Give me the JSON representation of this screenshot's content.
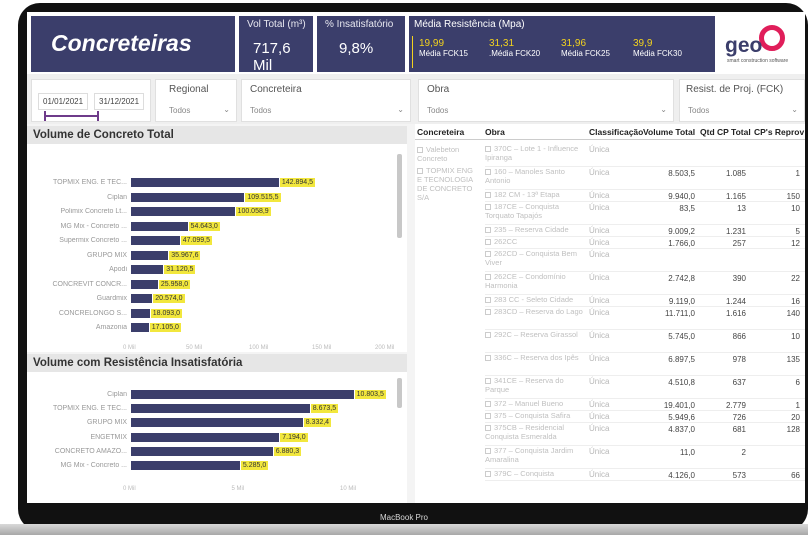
{
  "device_label": "MacBook Pro",
  "header": {
    "title": "Concreteiras",
    "kpis": [
      {
        "label": "Vol Total (m³)",
        "value": "717,6 Mil"
      },
      {
        "label": "% Insatisfatório",
        "value": "9,8%"
      }
    ],
    "resistencia": {
      "label": "Média Resistência (Mpa)",
      "items": [
        {
          "value": "19,99",
          "name": "Média FCK15"
        },
        {
          "value": "31,31",
          "name": ".Média FCK20"
        },
        {
          "value": "31,96",
          "name": "Média FCK25"
        },
        {
          "value": "39,9",
          "name": "Média FCK30"
        }
      ]
    },
    "logo": {
      "text": "geo",
      "sub": "smart construction software"
    }
  },
  "filters": {
    "date_start": "01/01/2021",
    "date_end": "31/12/2021",
    "regional": {
      "label": "Regional",
      "value": "Todos"
    },
    "concreteira": {
      "label": "Concreteira",
      "value": "Todos"
    },
    "obra": {
      "label": "Obra",
      "value": "Todos"
    },
    "fck": {
      "label": "Resist. de Proj. (FCK)",
      "value": "Todos"
    }
  },
  "chart_data": [
    {
      "type": "bar",
      "title": "Volume de Concreto Total",
      "categories": [
        "TOPMIX ENG. E TEC...",
        "Ciplan",
        "Polimix Concreto Lt...",
        "MG Mix - Concreto ...",
        "Supermix Concreto ...",
        "GRUPO MIX",
        "Apodi",
        "CONCREVIT CONCR...",
        "Guardmix",
        "CONCRELONGO S...",
        "Amazonia"
      ],
      "values": [
        142894.5,
        109515.5,
        100058.9,
        54643.0,
        47099.5,
        35967.6,
        31120.5,
        25958.0,
        20574.0,
        18093.0,
        17105.0
      ],
      "labels": [
        "142.894,5",
        "109.515,5",
        "100.058,9",
        "54.643,0",
        "47.099,5",
        "35.967,6",
        "31.120,5",
        "25.958,0",
        "20.574,0",
        "18.093,0",
        "17.105,0"
      ],
      "xticks": [
        "0 Mil",
        "50 Mil",
        "100 Mil",
        "150 Mil",
        "200 Mil"
      ],
      "xlim": [
        0,
        200000
      ]
    },
    {
      "type": "bar",
      "title": "Volume com Resistência Insatisfatória",
      "categories": [
        "Ciplan",
        "TOPMIX ENG. E TEC...",
        "GRUPO MIX",
        "ENGETMIX",
        "CONCRETO AMAZO...",
        "MG Mix - Concreto ..."
      ],
      "values": [
        10803.5,
        8673.5,
        8332.4,
        7194.0,
        6880.3,
        5285.0
      ],
      "labels": [
        "10.803,5",
        "8.673,5",
        "8.332,4",
        "7.194,0",
        "6.880,3",
        "5.285,0"
      ],
      "xticks": [
        "0 Mil",
        "5 Mil",
        "10 Mil"
      ],
      "xlim": [
        0,
        11500
      ]
    }
  ],
  "table": {
    "columns": [
      "Concreteira",
      "Obra",
      "Classificação",
      "Volume Total",
      "Qtd CP Total",
      "CP's Reprov"
    ],
    "concreteiras": [
      "Valebeton Concreto",
      "TOPMIX ENG E TECNOLOGIA DE CONCRETO S/A"
    ],
    "rows": [
      {
        "obra": "370C – Lote 1 - Influence Ipiranga",
        "class": "Única",
        "vol": "",
        "qtd": "",
        "rep": ""
      },
      {
        "obra": "160 – Manoles Santo Antonio",
        "class": "Única",
        "vol": "8.503,5",
        "qtd": "1.085",
        "rep": "1"
      },
      {
        "obra": "182 CM - 13ª Etapa",
        "class": "Única",
        "vol": "9.940,0",
        "qtd": "1.165",
        "rep": "150"
      },
      {
        "obra": "187CE – Conquista Torquato Tapajós",
        "class": "Única",
        "vol": "83,5",
        "qtd": "13",
        "rep": "10"
      },
      {
        "obra": "235 – Reserva Cidade",
        "class": "Única",
        "vol": "9.009,2",
        "qtd": "1.231",
        "rep": "5"
      },
      {
        "obra": "262CC",
        "class": "Única",
        "vol": "1.766,0",
        "qtd": "257",
        "rep": "12"
      },
      {
        "obra": "262CD – Conquista Bem Viver",
        "class": "Única",
        "vol": "",
        "qtd": "",
        "rep": ""
      },
      {
        "obra": "262CE – Condomínio Harmonia",
        "class": "Única",
        "vol": "2.742,8",
        "qtd": "390",
        "rep": "22"
      },
      {
        "obra": "283 CC - Seleto Cidade",
        "class": "Única",
        "vol": "9.119,0",
        "qtd": "1.244",
        "rep": "16"
      },
      {
        "obra": "283CD – Reserva do Lago",
        "class": "Única",
        "vol": "11.711,0",
        "qtd": "1.616",
        "rep": "140"
      },
      {
        "obra": "292C – Reserva Girassol",
        "class": "Única",
        "vol": "5.745,0",
        "qtd": "866",
        "rep": "10"
      },
      {
        "obra": "336C – Reserva dos Ipês",
        "class": "Única",
        "vol": "6.897,5",
        "qtd": "978",
        "rep": "135"
      },
      {
        "obra": "341CE – Reserva do Parque",
        "class": "Única",
        "vol": "4.510,8",
        "qtd": "637",
        "rep": "6"
      },
      {
        "obra": "372 – Manuel Bueno",
        "class": "Única",
        "vol": "19.401,0",
        "qtd": "2.779",
        "rep": "1"
      },
      {
        "obra": "375 – Conquista Safira",
        "class": "Única",
        "vol": "5.949,6",
        "qtd": "726",
        "rep": "20"
      },
      {
        "obra": "375CB – Residencial Conquista Esmeralda",
        "class": "Única",
        "vol": "4.837,0",
        "qtd": "681",
        "rep": "128"
      },
      {
        "obra": "377 – Conquista Jardim Amaralina",
        "class": "Única",
        "vol": "11,0",
        "qtd": "2",
        "rep": ""
      },
      {
        "obra": "379C – Conquista",
        "class": "Única",
        "vol": "4.126,0",
        "qtd": "573",
        "rep": "66"
      }
    ]
  }
}
